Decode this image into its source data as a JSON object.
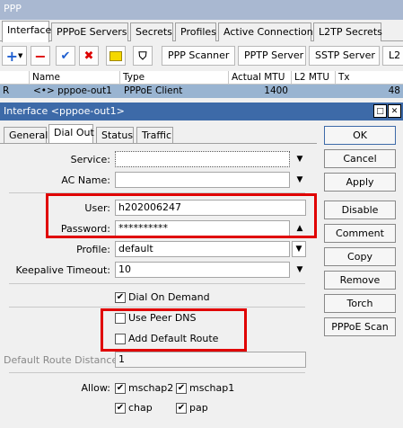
{
  "window": {
    "title": "PPP"
  },
  "tabs": [
    "Interface",
    "PPPoE Servers",
    "Secrets",
    "Profiles",
    "Active Connections",
    "L2TP Secrets"
  ],
  "toolbar": {
    "buttons": [
      "PPP Scanner",
      "PPTP Server",
      "SSTP Server",
      "L2"
    ],
    "icons": [
      "add-icon",
      "remove-icon",
      "enable-icon",
      "disable-icon",
      "comment-icon",
      "filter-icon"
    ]
  },
  "grid": {
    "columns": [
      "Name",
      "Type",
      "Actual MTU",
      "L2 MTU",
      "Tx"
    ],
    "row": {
      "flag": "R",
      "name": "<•> pppoe-out1",
      "type": "PPPoE Client",
      "mtu": "1400",
      "l2mtu": "",
      "tx": "48"
    }
  },
  "dialog": {
    "title": "Interface <pppoe-out1>",
    "tabs": [
      "General",
      "Dial Out",
      "Status",
      "Traffic"
    ],
    "fields": {
      "service_label": "Service:",
      "service_value": "",
      "ac_name_label": "AC Name:",
      "ac_name_value": "",
      "user_label": "User:",
      "user_value": "h202006247",
      "password_label": "Password:",
      "password_value": "**********",
      "profile_label": "Profile:",
      "profile_value": "default",
      "keepalive_label": "Keepalive Timeout:",
      "keepalive_value": "10",
      "dod_label": "Dial On Demand",
      "dod_checked": true,
      "peer_dns_label": "Use Peer DNS",
      "peer_dns_checked": false,
      "default_route_label": "Add Default Route",
      "default_route_checked": false,
      "route_distance_label": "Default Route Distance:",
      "route_distance_value": "1",
      "allow_label": "Allow:",
      "allow": [
        "mschap2",
        "mschap1",
        "chap",
        "pap"
      ]
    },
    "buttons": [
      "OK",
      "Cancel",
      "Apply",
      "Disable",
      "Comment",
      "Copy",
      "Remove",
      "Torch",
      "PPPoE Scan"
    ]
  }
}
